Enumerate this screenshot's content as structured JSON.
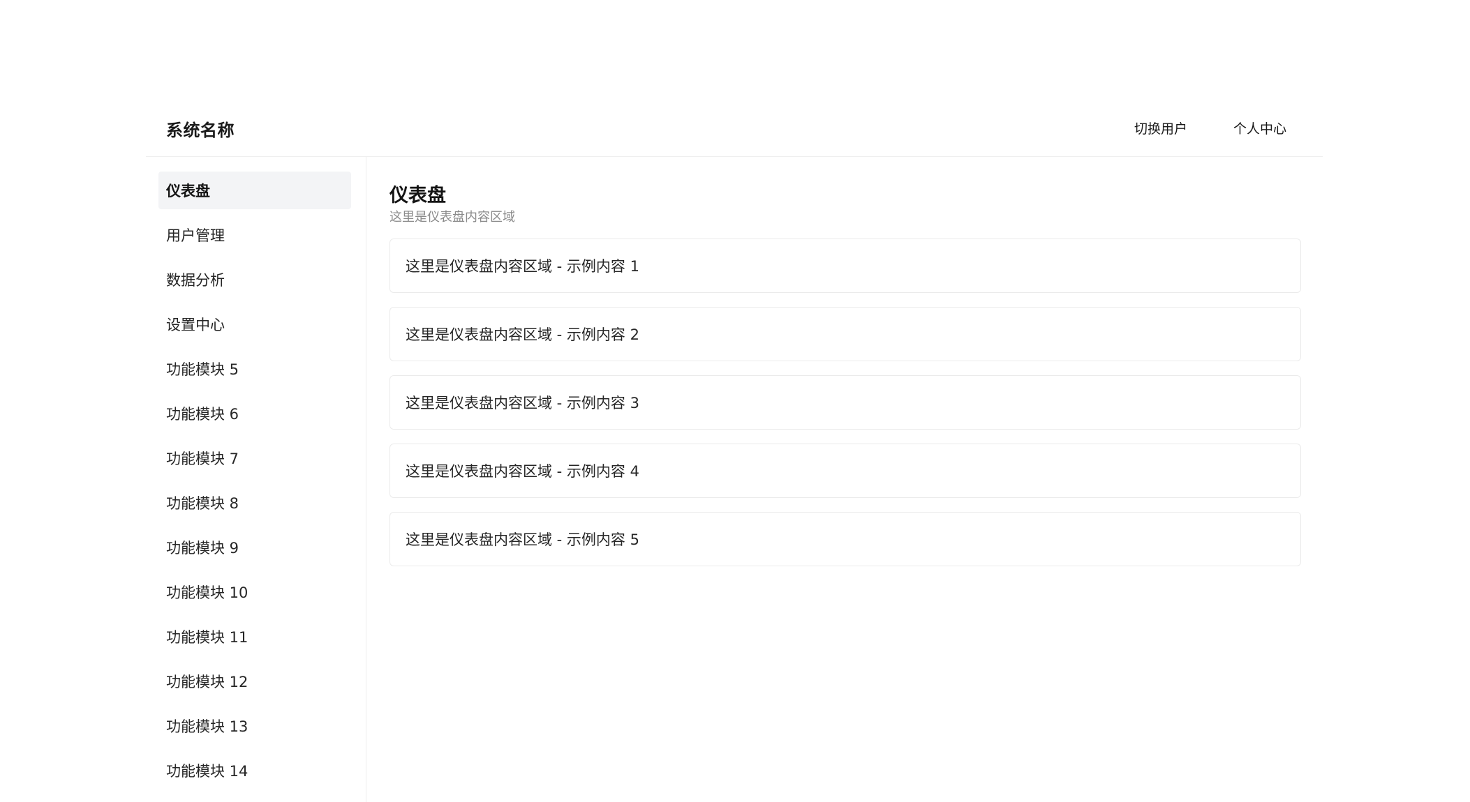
{
  "header": {
    "title": "系统名称",
    "switch_user": "切换用户",
    "profile": "个人中心"
  },
  "sidebar": {
    "items": [
      {
        "label": "仪表盘",
        "active": true
      },
      {
        "label": "用户管理"
      },
      {
        "label": "数据分析"
      },
      {
        "label": "设置中心"
      },
      {
        "label": "功能模块 5"
      },
      {
        "label": "功能模块 6"
      },
      {
        "label": "功能模块 7"
      },
      {
        "label": "功能模块 8"
      },
      {
        "label": "功能模块 9"
      },
      {
        "label": "功能模块 10"
      },
      {
        "label": "功能模块 11"
      },
      {
        "label": "功能模块 12"
      },
      {
        "label": "功能模块 13"
      },
      {
        "label": "功能模块 14"
      }
    ]
  },
  "main": {
    "title": "仪表盘",
    "subtitle": "这里是仪表盘内容区域",
    "cards": [
      {
        "text": "这里是仪表盘内容区域 - 示例内容 1"
      },
      {
        "text": "这里是仪表盘内容区域 - 示例内容 2"
      },
      {
        "text": "这里是仪表盘内容区域 - 示例内容 3"
      },
      {
        "text": "这里是仪表盘内容区域 - 示例内容 4"
      },
      {
        "text": "这里是仪表盘内容区域 - 示例内容 5"
      }
    ]
  },
  "colors": {
    "active_bg": "#f3f4f6",
    "border": "#ebebeb",
    "subtitle": "#8a8a8a"
  }
}
